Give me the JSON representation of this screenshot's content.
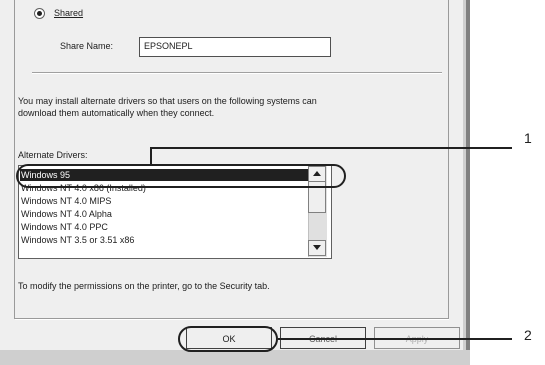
{
  "sharing": {
    "shared_label": "Shared",
    "share_name_label": "Share Name:",
    "share_name_value": "EPSONEPL",
    "info_text_line1": "You may install alternate drivers so that users on the following systems can",
    "info_text_line2": "download them automatically when they connect."
  },
  "alternate_drivers": {
    "label": "Alternate Drivers:",
    "items": [
      "Windows 95",
      "Windows NT 4.0 x86 (Installed)",
      "Windows NT 4.0 MIPS",
      "Windows NT 4.0 Alpha",
      "Windows NT 4.0 PPC",
      "Windows NT 3.5 or 3.51 x86"
    ]
  },
  "footer_text": "To modify the permissions on the printer, go to the Security tab.",
  "buttons": {
    "ok": "OK",
    "cancel": "Cancel",
    "apply": "Apply"
  },
  "callouts": {
    "one": "1",
    "two": "2"
  }
}
